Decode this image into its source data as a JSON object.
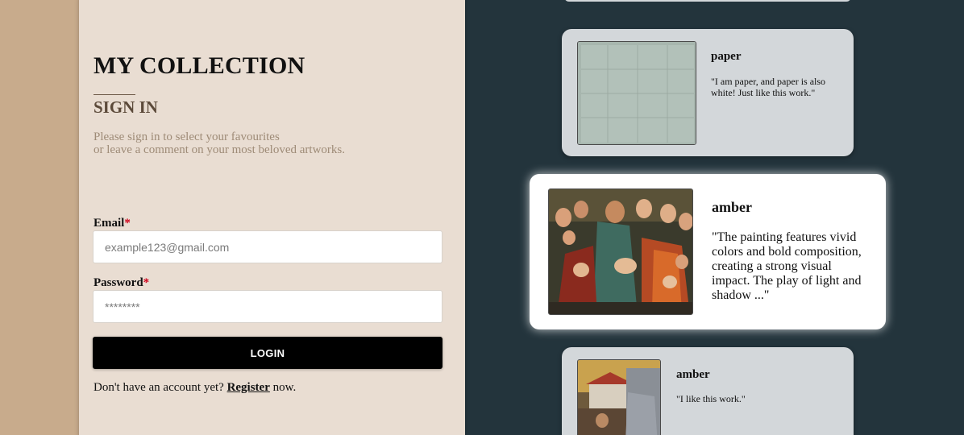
{
  "login": {
    "title": "MY COLLECTION",
    "subtitle": "SIGN IN",
    "description_line1": "Please sign in to select your favourites",
    "description_line2": "or leave a comment on your most beloved artworks.",
    "email_label": "Email",
    "email_placeholder": "example123@gmail.com",
    "password_label": "Password",
    "password_placeholder": "********",
    "required_marker": "*",
    "login_button": "LOGIN",
    "register_prefix": "Don't have an account yet?",
    "register_link": "Register",
    "register_suffix": "now."
  },
  "comments": [
    {
      "user": "paper",
      "text": "\"I am paper, and paper is also white! Just like this work.\"",
      "image": "white-paper-artwork"
    },
    {
      "user": "amber",
      "text": "\"The painting features vivid colors and bold composition, creating a strong visual impact. The play of light and shadow ...\"",
      "image": "christ-blessing-children-painting"
    },
    {
      "user": "amber",
      "text": "\"I like this work.\"",
      "image": "street-scene-painting"
    }
  ],
  "colors": {
    "background": "#23343c",
    "left_strip": "#c8ab8c",
    "panel": "#e9ddd2",
    "card": "#d3d7da",
    "button": "#000000",
    "required": "#d0021b"
  }
}
